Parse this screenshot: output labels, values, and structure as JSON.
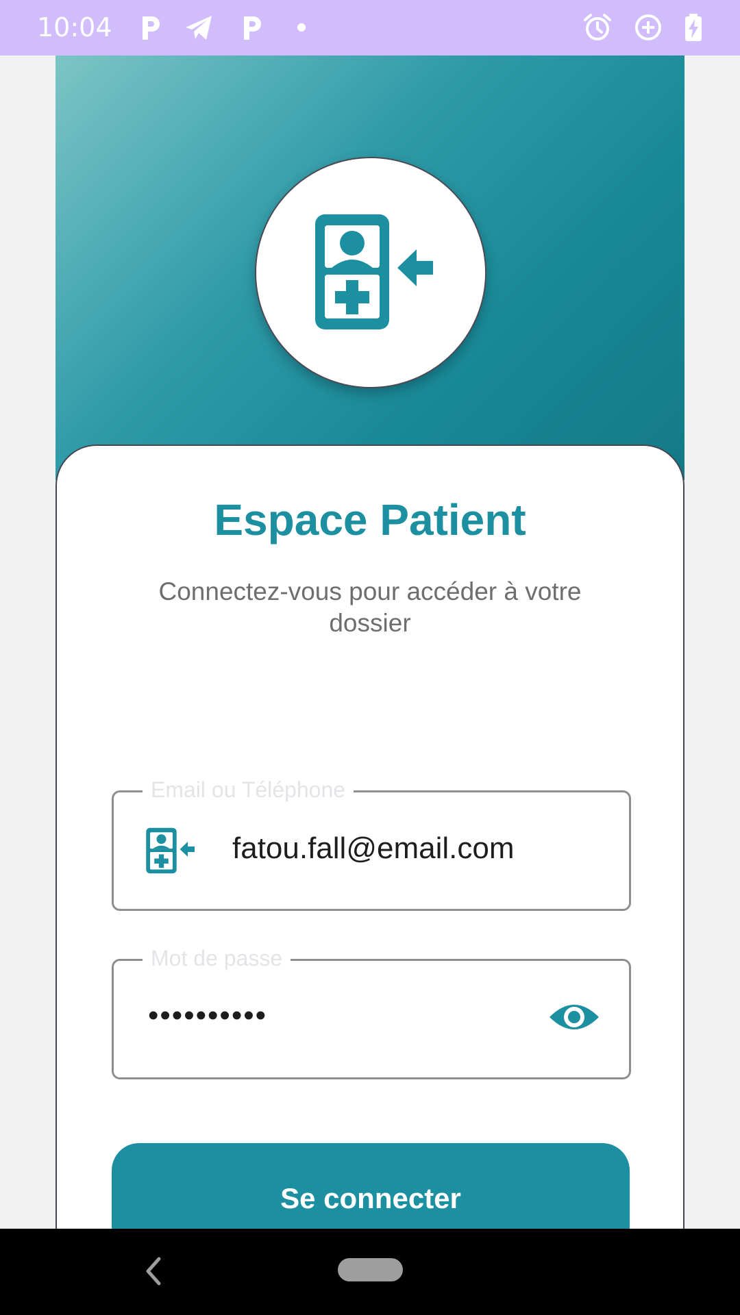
{
  "status_bar": {
    "time": "10:04",
    "left_icons": [
      "parking-p-icon",
      "telegram-icon",
      "parking-p-icon",
      "dot-icon"
    ],
    "right_icons": [
      "alarm-icon",
      "data-saver-icon",
      "battery-charging-icon"
    ]
  },
  "login": {
    "logo_icon": "patient-login-icon",
    "title": "Espace Patient",
    "subtitle": "Connectez-vous pour accéder à votre dossier",
    "email_field": {
      "label": "Email ou Téléphone",
      "value": "fatou.fall@email.com",
      "icon": "patient-login-icon"
    },
    "password_field": {
      "label": "Mot de passe",
      "value": "••••••••••",
      "toggle_icon": "eye-icon"
    },
    "submit_label": "Se connecter"
  },
  "nav_bar": {
    "back_icon": "back-chevron-icon",
    "home_icon": "home-pill-icon"
  },
  "colors": {
    "primary": "#1c8fa1",
    "status_bar": "#d2bdfc",
    "hero_gradient_start": "#7cc5c6",
    "hero_gradient_end": "#147987"
  }
}
